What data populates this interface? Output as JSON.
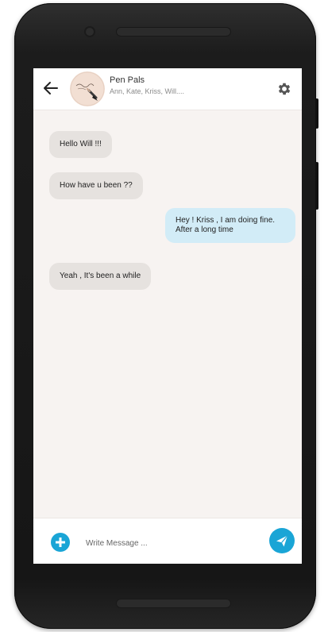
{
  "header": {
    "title": "Pen Pals",
    "members": "Ann,  Kate, Kriss, Will...."
  },
  "messages": [
    {
      "direction": "incoming",
      "text": "Hello Will !!!"
    },
    {
      "direction": "incoming",
      "text": "How have u been ??"
    },
    {
      "direction": "outgoing",
      "text": "Hey ! Kriss , I am doing fine.\nAfter a long time"
    },
    {
      "direction": "incoming",
      "text": "Yeah , It's been a while"
    }
  ],
  "composer": {
    "placeholder": "Write Message ..."
  },
  "colors": {
    "accent": "#1aa5d6",
    "incoming_bubble": "#e6e2df",
    "outgoing_bubble": "#d2ecf7",
    "chat_background": "#f7f3f1"
  },
  "icons": {
    "back": "arrow-left-icon",
    "settings": "gear-icon",
    "add": "plus-circle-icon",
    "send": "paper-plane-icon"
  }
}
